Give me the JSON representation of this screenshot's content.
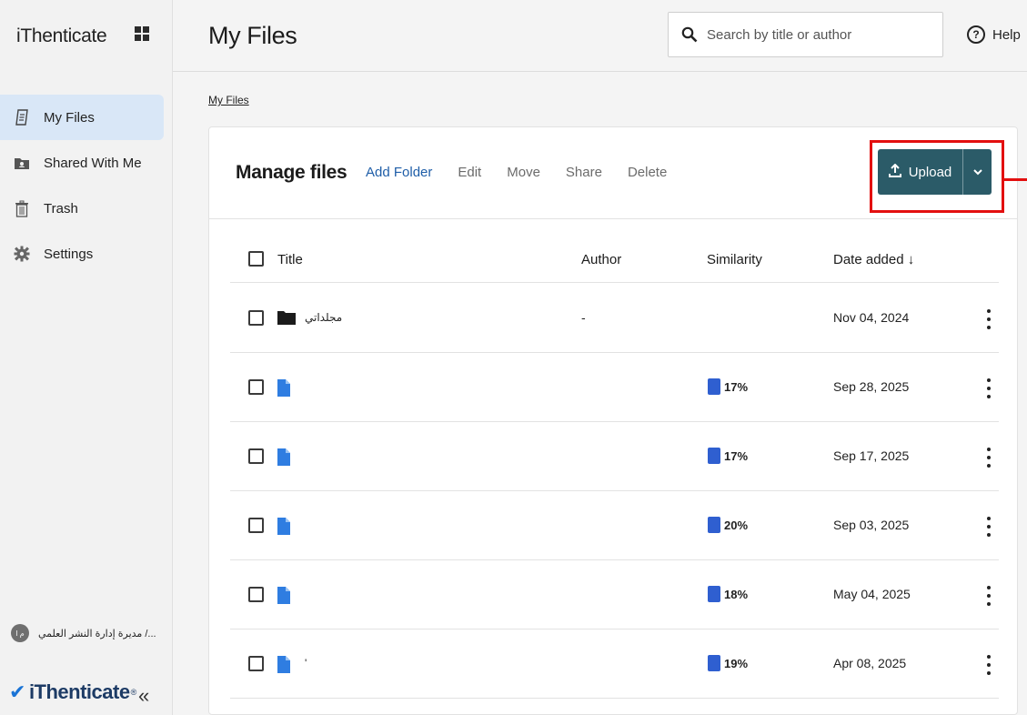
{
  "app": {
    "brand": "iThenticate",
    "footer_brand": "iThenticate",
    "footer_tm": "®"
  },
  "sidebar": {
    "items": [
      {
        "label": "My Files",
        "icon": "file-list-icon",
        "active": true
      },
      {
        "label": "Shared With Me",
        "icon": "shared-folder-icon",
        "active": false
      },
      {
        "label": "Trash",
        "icon": "trash-icon",
        "active": false
      },
      {
        "label": "Settings",
        "icon": "gear-icon",
        "active": false
      }
    ],
    "user": {
      "name": "مديرة إدارة النشر العلمي /...",
      "initials": "م ا"
    },
    "collapse_glyph": "«"
  },
  "header": {
    "title": "My Files",
    "search_placeholder": "Search by title or author",
    "help_label": "Help"
  },
  "breadcrumb": "My Files",
  "card": {
    "title": "Manage files",
    "actions": [
      "Add Folder",
      "Edit",
      "Move",
      "Share",
      "Delete"
    ],
    "upload_label": "Upload"
  },
  "table": {
    "headers": {
      "title": "Title",
      "author": "Author",
      "similarity": "Similarity",
      "date": "Date added",
      "sort_glyph": "↓"
    },
    "rows": [
      {
        "type": "folder",
        "name": "مجلداتي",
        "author": "-",
        "similarity": "",
        "date": "Nov 04, 2024"
      },
      {
        "type": "file",
        "name": "",
        "author": "",
        "similarity": "17%",
        "date": "Sep 28, 2025"
      },
      {
        "type": "file",
        "name": "",
        "author": "",
        "similarity": "17%",
        "date": "Sep 17, 2025"
      },
      {
        "type": "file",
        "name": "",
        "author": "",
        "similarity": "20%",
        "date": "Sep 03, 2025"
      },
      {
        "type": "file",
        "name": "",
        "author": "",
        "similarity": "18%",
        "date": "May 04, 2025"
      },
      {
        "type": "file",
        "name": "'",
        "author": "",
        "similarity": "19%",
        "date": "Apr 08, 2025"
      }
    ]
  },
  "colors": {
    "accent": "#1f5ea8",
    "upload_bg": "#2b5b68",
    "highlight": "#e30f0f",
    "similarity": "#2f5fd0",
    "file_icon": "#2f7de1"
  }
}
